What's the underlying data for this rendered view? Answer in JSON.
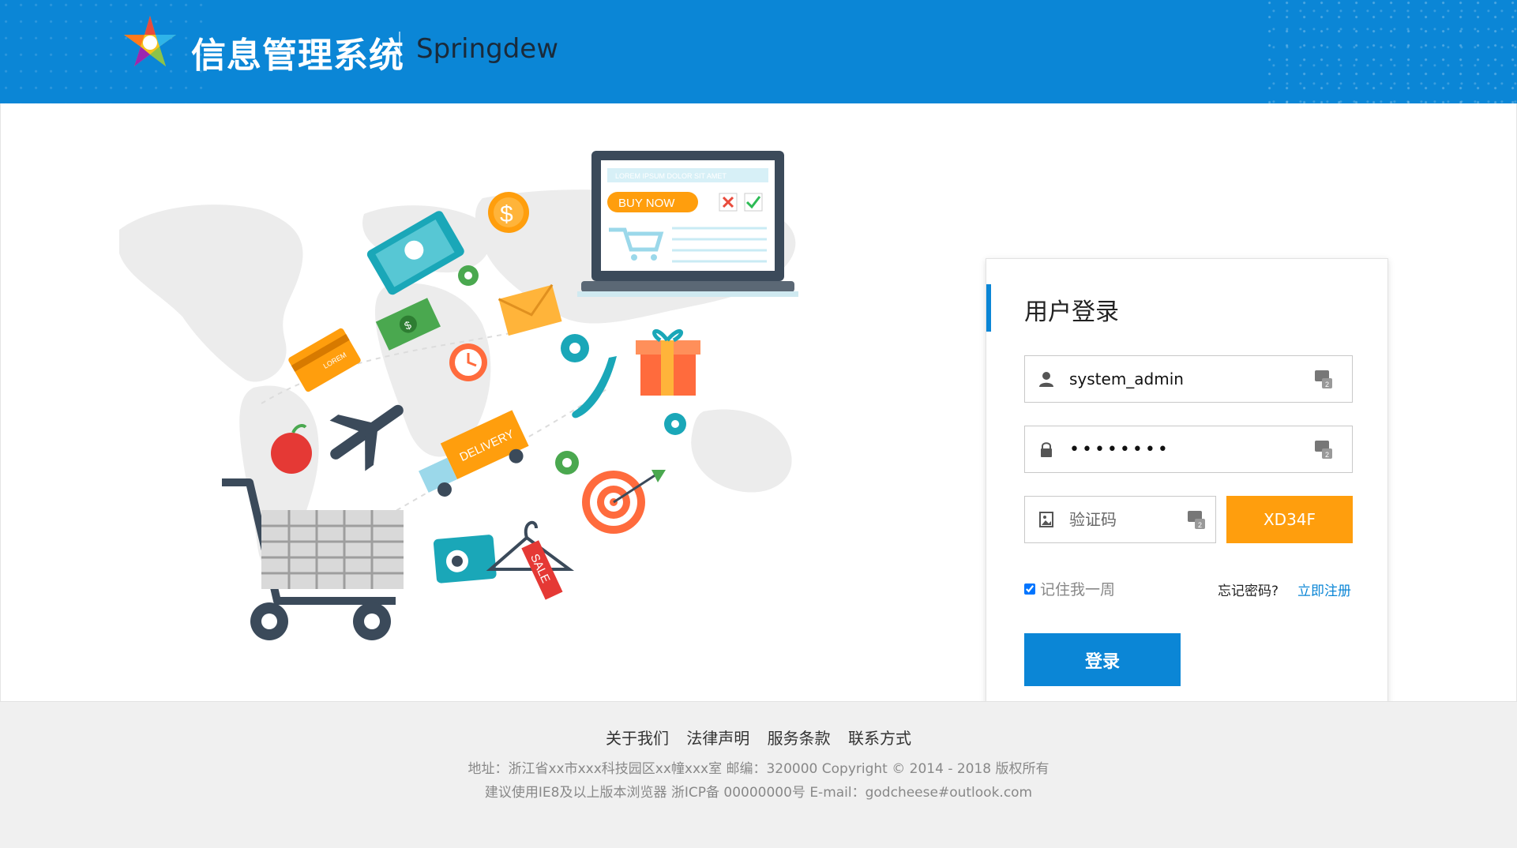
{
  "header": {
    "brand": "信息管理系统",
    "subtitle": "Springdew"
  },
  "illustration": {
    "laptop_banner": "LOREM IPSUM DOLOR SIT AMET",
    "buy_now": "BUY NOW",
    "delivery": "DELIVERY",
    "sale": "SALE",
    "card": "LOREM"
  },
  "login": {
    "title": "用户登录",
    "username_value": "system_admin",
    "password_value": "••••••••",
    "captcha_placeholder": "验证码",
    "captcha_code": "XD34F",
    "remember_label": "记住我一周",
    "forgot_label": "忘记密码?",
    "register_label": "立即注册",
    "submit_label": "登录"
  },
  "footer": {
    "links": [
      "关于我们",
      "法律声明",
      "服务条款",
      "联系方式"
    ],
    "address": "地址：浙江省xx市xxx科技园区xx幢xxx室 邮编：320000  Copyright © 2014 - 2018  版权所有",
    "browser_note": "建议使用IE8及以上版本浏览器 浙ICP备 00000000号 E-mail：godcheese#outlook.com"
  },
  "colors": {
    "primary": "#0b86d6",
    "captcha": "#ff9e0d"
  }
}
